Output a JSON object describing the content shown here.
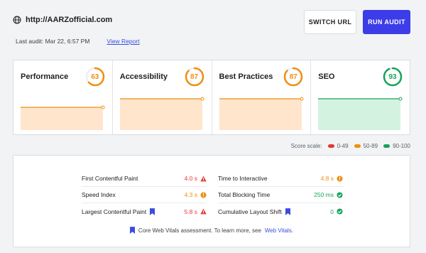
{
  "header": {
    "url": "http://AARZofficial.com",
    "last_audit": "Last audit: Mar 22, 6:57 PM",
    "view_report": "View Report",
    "switch_url": "SWITCH URL",
    "run_audit": "RUN AUDIT",
    "run_color": "#3c3ce8"
  },
  "cards": [
    {
      "title": "Performance",
      "score": "63",
      "status": "average"
    },
    {
      "title": "Accessibility",
      "score": "87",
      "status": "average"
    },
    {
      "title": "Best Practices",
      "score": "87",
      "status": "average"
    },
    {
      "title": "SEO",
      "score": "93",
      "status": "good"
    }
  ],
  "colors": {
    "poor": "#e53935",
    "average": "#ef8f13",
    "good": "#18a35a",
    "average_fill": "#ffe5cc",
    "good_fill": "#d4f2e0"
  },
  "scale": {
    "label": "Score scale:",
    "poor": "0-49",
    "average": "50-89",
    "good": "90-100"
  },
  "metrics": {
    "left": [
      {
        "label": "First Contentful Paint",
        "value": "4.0 s",
        "status": "poor",
        "cwv": false
      },
      {
        "label": "Speed Index",
        "value": "4.3 s",
        "status": "average",
        "cwv": false
      },
      {
        "label": "Largest Contentful Paint",
        "value": "5.8 s",
        "status": "poor",
        "cwv": true
      }
    ],
    "right": [
      {
        "label": "Time to Interactive",
        "value": "4.8 s",
        "status": "average",
        "cwv": false
      },
      {
        "label": "Total Blocking Time",
        "value": "250 ms",
        "status": "good",
        "cwv": false
      },
      {
        "label": "Cumulative Layout Shift",
        "value": "0",
        "status": "good",
        "cwv": true
      }
    ]
  },
  "cwv_note": {
    "text": "Core Web Vitals assessment. To learn more, see",
    "link": "Web Vitals",
    "end": "."
  }
}
